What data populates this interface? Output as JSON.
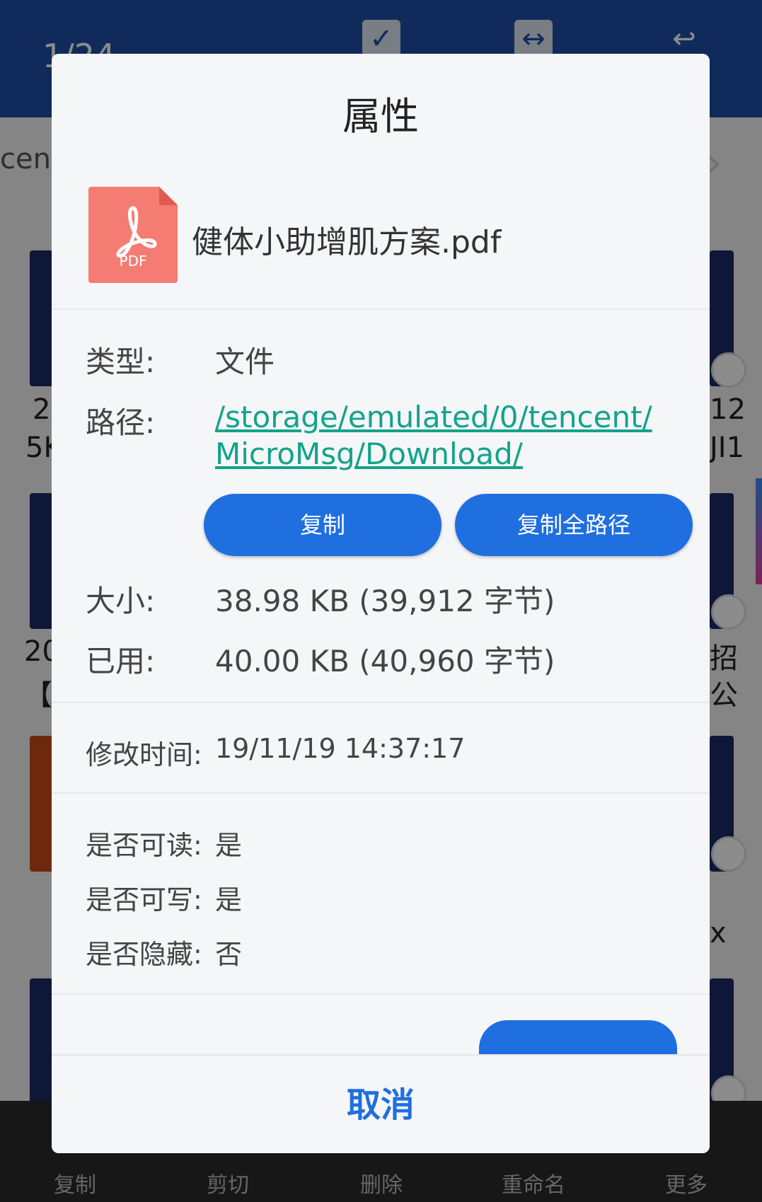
{
  "background": {
    "page_count": "1/24",
    "breadcrumb_fragment": "cent",
    "left_texts": [
      "2",
      "5K",
      "20",
      "【",
      "...",
      "..."
    ],
    "right_texts": [
      "12",
      "JI1",
      "招",
      "公",
      "x"
    ],
    "bottom_bar": {
      "items": [
        "复制",
        "剪切",
        "删除",
        "重命名",
        "更多"
      ]
    }
  },
  "dialog": {
    "title": "属性",
    "file": {
      "name": "健体小助增肌方案.pdf",
      "icon": "pdf-file-icon",
      "icon_label": "PDF",
      "icon_color": "#f47c72"
    },
    "type": {
      "label": "类型:",
      "value": "文件"
    },
    "path": {
      "label": "路径:",
      "line1": "/storage/emulated/0/tencent/",
      "line2": "MicroMsg/Download/",
      "color": "#13a38a"
    },
    "buttons": {
      "copy": "复制",
      "copy_full_path": "复制全路径"
    },
    "size": {
      "label": "大小:",
      "value": "38.98 KB (39,912 字节)"
    },
    "used": {
      "label": "已用:",
      "value": "40.00 KB (40,960 字节)"
    },
    "modified": {
      "label": "修改时间:",
      "value": "19/11/19 14:37:17"
    },
    "readable": {
      "label": "是否可读:",
      "value": "是"
    },
    "writable": {
      "label": "是否可写:",
      "value": "是"
    },
    "hidden": {
      "label": "是否隐藏:",
      "value": "否"
    },
    "cancel": "取消",
    "accent_color": "#1f6fe0"
  }
}
